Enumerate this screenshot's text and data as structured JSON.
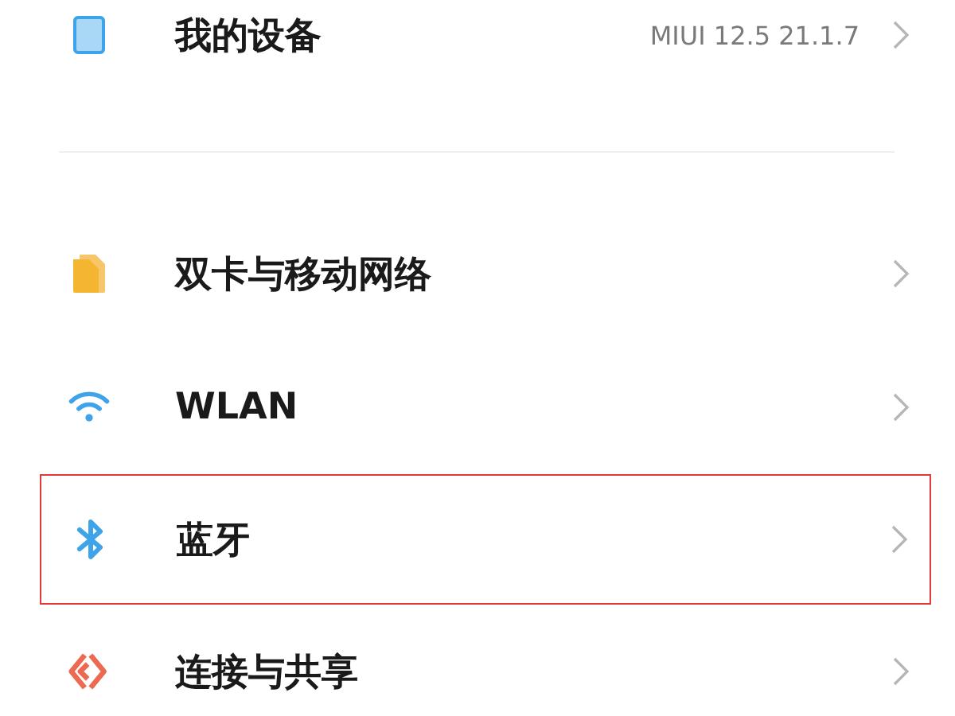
{
  "top_item": {
    "kind": "device",
    "label": "我的设备",
    "value": "MIUI 12.5 21.1.7"
  },
  "items": [
    {
      "kind": "sim",
      "label": "双卡与移动网络",
      "highlighted": false
    },
    {
      "kind": "wifi",
      "label": "WLAN",
      "highlighted": false
    },
    {
      "kind": "bluetooth",
      "label": "蓝牙",
      "highlighted": true
    },
    {
      "kind": "share",
      "label": "连接与共享",
      "highlighted": false
    }
  ]
}
